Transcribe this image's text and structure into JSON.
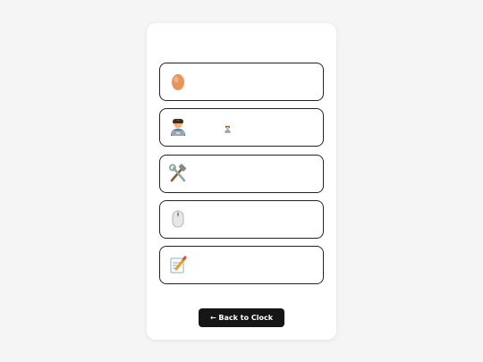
{
  "menu": {
    "items": [
      {
        "icon": "egg-icon",
        "label": ""
      },
      {
        "icon": "technologist-icon",
        "label": "",
        "secondary_icon": "technologist-small-icon"
      },
      {
        "icon": "hammer-and-wrench-icon",
        "label": ""
      },
      {
        "icon": "computer-mouse-icon",
        "label": ""
      },
      {
        "icon": "memo-icon",
        "label": ""
      }
    ]
  },
  "back_button": {
    "label": "← Back to Clock"
  },
  "colors": {
    "button_bg": "#161616",
    "button_text": "#ffffff",
    "card_bg": "#ffffff",
    "page_bg": "#f5f5f5",
    "item_border": "#222222"
  }
}
